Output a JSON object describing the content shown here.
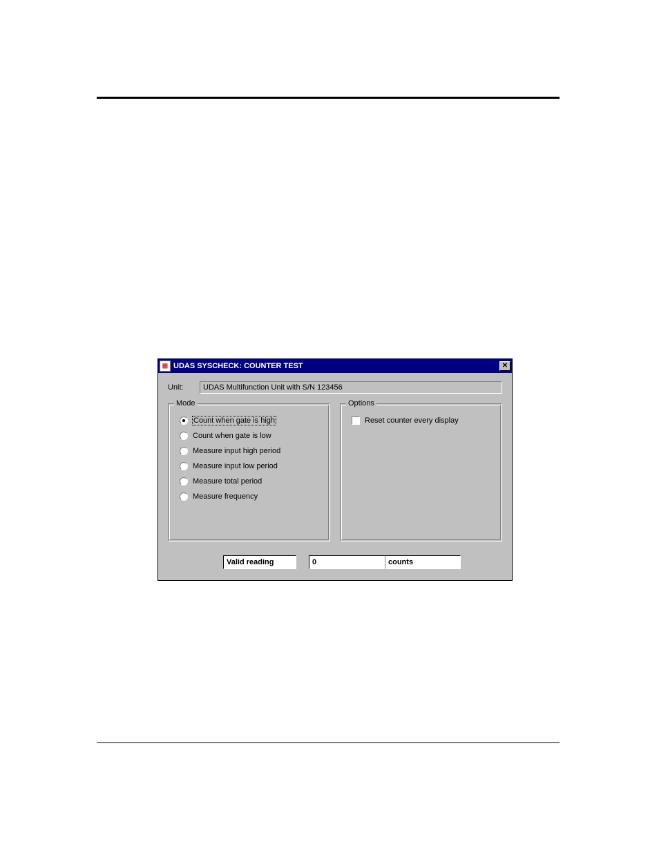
{
  "dialog": {
    "title": "UDAS SYSCHECK: COUNTER TEST",
    "icon_name": "app-icon",
    "unit_label": "Unit:",
    "unit_value": "UDAS Multifunction Unit with S/N  123456"
  },
  "mode": {
    "legend": "Mode",
    "selected_index": 0,
    "options": [
      "Count when gate is high",
      "Count when gate is low",
      "Measure input high period",
      "Measure input low period",
      "Measure total period",
      "Measure frequency"
    ]
  },
  "options": {
    "legend": "Options",
    "reset_label": "Reset counter every display",
    "reset_checked": false
  },
  "status": {
    "message": "Valid reading",
    "value": "0",
    "units": "counts"
  }
}
